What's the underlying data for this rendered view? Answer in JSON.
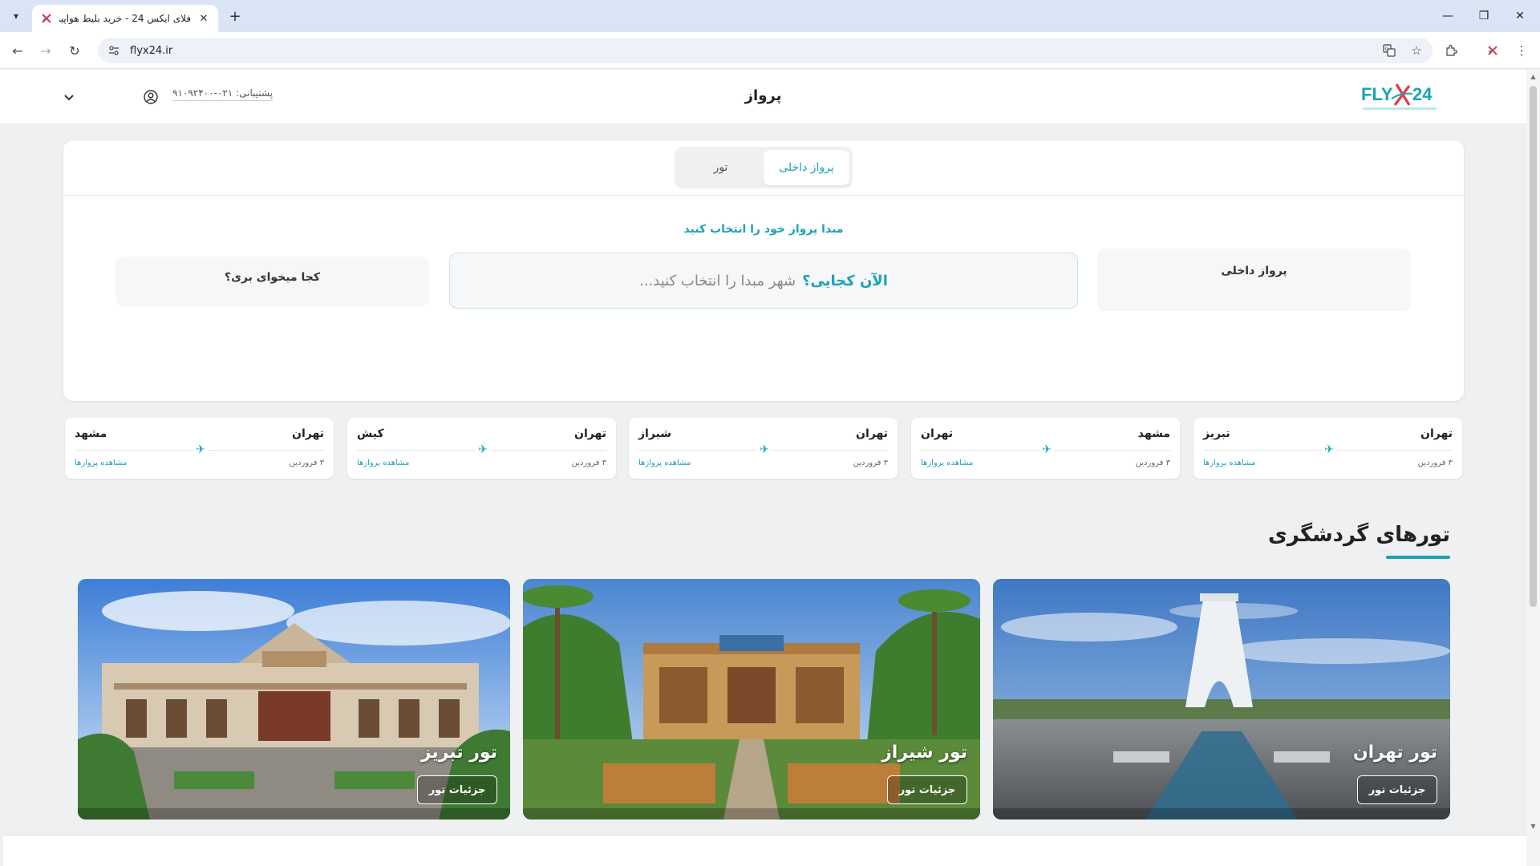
{
  "browser": {
    "tab_title": "فلای ایکس 24 - خرید بلیط هواپیما",
    "url": "flyx24.ir",
    "new_tab": "+",
    "close": "✕"
  },
  "header": {
    "title": "پرواز",
    "support": "پشتیبانی: ۰۲۱-۹۱۰۹۲۴۰۰"
  },
  "search": {
    "tabs": [
      "پرواز داخلی",
      "تور"
    ],
    "active_tab": 0,
    "hint": "مبدا پرواز خود را انتخاب کنید",
    "type_label": "پرواز داخلی",
    "origin_question": "الآن کجایی؟",
    "origin_placeholder": "شهر مبدا را انتخاب کنید...",
    "destination_label": "کجا میخوای بری؟"
  },
  "routes": [
    {
      "from": "تهران",
      "to": "تبریز",
      "date": "۳ فروردین",
      "link": "مشاهده پروازها"
    },
    {
      "from": "مشهد",
      "to": "تهران",
      "date": "۳ فروردین",
      "link": "مشاهده پروازها"
    },
    {
      "from": "تهران",
      "to": "شیراز",
      "date": "۳ فروردین",
      "link": "مشاهده پروازها"
    },
    {
      "from": "تهران",
      "to": "کیش",
      "date": "۳ فروردین",
      "link": "مشاهده پروازها"
    },
    {
      "from": "تهران",
      "to": "مشهد",
      "date": "۳ فروردین",
      "link": "مشاهده پروازها"
    }
  ],
  "tours_section": {
    "title": "تورهای گردشگری",
    "tours": [
      {
        "name": "تور تهران",
        "button": "جزئیات تور"
      },
      {
        "name": "تور شیراز",
        "button": "جزئیات تور"
      },
      {
        "name": "تور تبریز",
        "button": "جزئیات تور"
      }
    ]
  },
  "colors": {
    "accent": "#1aa3b7",
    "logo_red": "#e53945",
    "page_bg": "#eef0f2"
  }
}
